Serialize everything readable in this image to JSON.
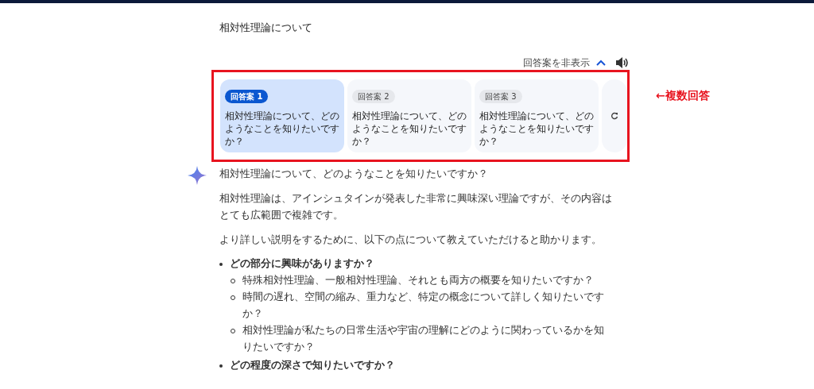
{
  "prompt": "相対性理論について",
  "drafts_toggle": {
    "label": "回答案を非表示",
    "expanded": true
  },
  "drafts": [
    {
      "label": "回答案 1",
      "text": "相対性理論について、どのようなことを知りたいですか？",
      "selected": true
    },
    {
      "label": "回答案 2",
      "text": "相対性理論について、どのようなことを知りたいですか？",
      "selected": false
    },
    {
      "label": "回答案 3",
      "text": "相対性理論について、どのようなことを知りたいですか？",
      "selected": false
    }
  ],
  "annotation": "←複数回答",
  "response": {
    "paragraphs": [
      "相対性理論について、どのようなことを知りたいですか？",
      "相対性理論は、アインシュタインが発表した非常に興味深い理論ですが、その内容はとても広範囲で複雑です。",
      "より詳しい説明をするために、以下の点について教えていただけると助かります。"
    ],
    "list": [
      {
        "text": "どの部分に興味がありますか？",
        "children": [
          {
            "text": "特殊相対性理論、一般相対性理論、それとも両方の概要を知りたいですか？"
          },
          {
            "text": "時間の遅れ、空間の縮み、重力など、特定の概念について詳しく知りたいですか？"
          },
          {
            "text": "相対性理論が私たちの日常生活や宇宙の理解にどのように関わっているかを知りたいですか？"
          }
        ]
      },
      {
        "text": "どの程度の深さで知りたいですか？"
      }
    ]
  }
}
